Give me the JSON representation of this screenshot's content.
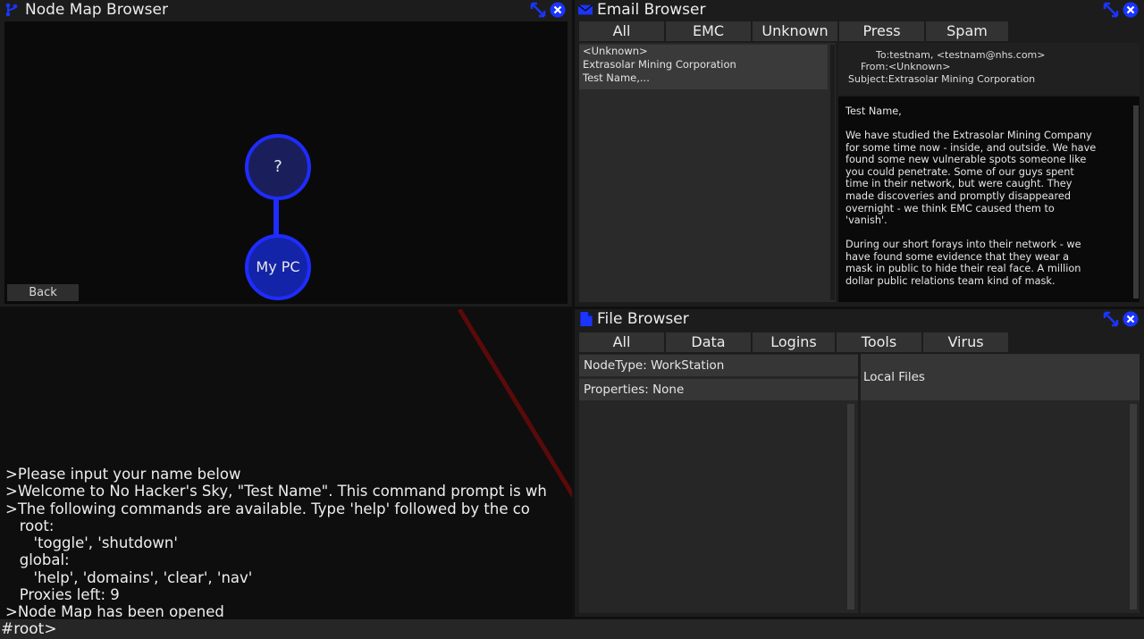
{
  "colors": {
    "accent": "#1a35ff",
    "node_fill": "#1a1f5c",
    "node_border": "#1f2cff",
    "pc_fill": "#1424a8",
    "red_line": "#5a0a0a"
  },
  "node_map": {
    "title": "Node Map Browser",
    "title_icon": "branch-icon",
    "nodes": {
      "unknown_label": "?",
      "mypc_label": "My PC"
    },
    "back_label": "Back"
  },
  "email": {
    "title": "Email Browser",
    "title_icon": "envelope-icon",
    "tabs": [
      "All",
      "EMC",
      "Unknown",
      "Press",
      "Spam"
    ],
    "list_item": [
      "<Unknown>",
      "Extrasolar Mining Corporation",
      "Test Name,..."
    ],
    "header": {
      "to": "To:testnam, <testnam@nhs.com>",
      "from": "From:<Unknown>",
      "subject": "Subject:Extrasolar Mining Corporation"
    },
    "body": {
      "greeting": "Test Name,",
      "p1": [
        "We have studied the Extrasolar Mining Company",
        "for some time now - inside, and outside. We have",
        "found some new vulnerable spots someone like",
        "you could penetrate. Some of our guys spent",
        "time in their network, but were caught. They",
        "made discoveries and promptly disappeared",
        "overnight - we think EMC caused them to",
        "'vanish'."
      ],
      "p2": [
        "During our short forays into their network - we",
        "have found some evidence that they wear a",
        "mask in public to hide their real face. A million",
        "dollar public relations team kind of mask."
      ]
    }
  },
  "file_browser": {
    "title": "File Browser",
    "title_icon": "file-icon",
    "tabs": [
      "All",
      "Data",
      "Logins",
      "Tools",
      "Virus"
    ],
    "nodetype": "NodeType: WorkStation",
    "properties": "Properties: None",
    "local_files": "Local Files"
  },
  "console": {
    "lines": [
      ">Please input your name below",
      ">Welcome to No Hacker's Sky, \"Test Name\". This command prompt is wh",
      ">The following commands are available. Type 'help' followed by the co",
      "   root:",
      "      'toggle', 'shutdown'",
      "   global:",
      "      'help', 'domains', 'clear', 'nav'",
      "   Proxies left: 9",
      ">Node Map has been opened"
    ],
    "prompt": "#root>"
  }
}
